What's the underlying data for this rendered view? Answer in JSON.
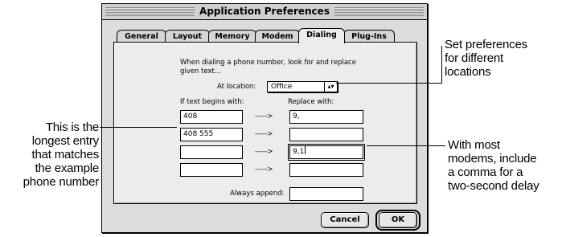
{
  "window": {
    "title": "Application Preferences"
  },
  "tabs": [
    {
      "label": "General"
    },
    {
      "label": "Layout"
    },
    {
      "label": "Memory"
    },
    {
      "label": "Modem"
    },
    {
      "label": "Dialing",
      "active": true
    },
    {
      "label": "Plug-Ins"
    }
  ],
  "dialing": {
    "description_line1": "When dialing a phone number, look for and replace",
    "description_line2": "given text...",
    "location_label": "At location:",
    "location_value": "Office",
    "col_begins": "If text begins with:",
    "col_replace": "Replace with:",
    "arrow": "----->",
    "rows": [
      {
        "begins": "408",
        "replace": "9,"
      },
      {
        "begins": "408 555",
        "replace": ""
      },
      {
        "begins": "",
        "replace": "9,1"
      },
      {
        "begins": "",
        "replace": ""
      }
    ],
    "always_append_label": "Always append:",
    "always_append_value": ""
  },
  "buttons": {
    "cancel": "Cancel",
    "ok": "OK"
  },
  "annotations": {
    "left": [
      "This is the",
      "longest entry",
      "that matches",
      "the example",
      "phone number"
    ],
    "right_top": [
      "Set preferences",
      "for different",
      "locations"
    ],
    "right_bottom": [
      "With most",
      "modems, include",
      "a comma for a",
      "two-second delay"
    ]
  }
}
